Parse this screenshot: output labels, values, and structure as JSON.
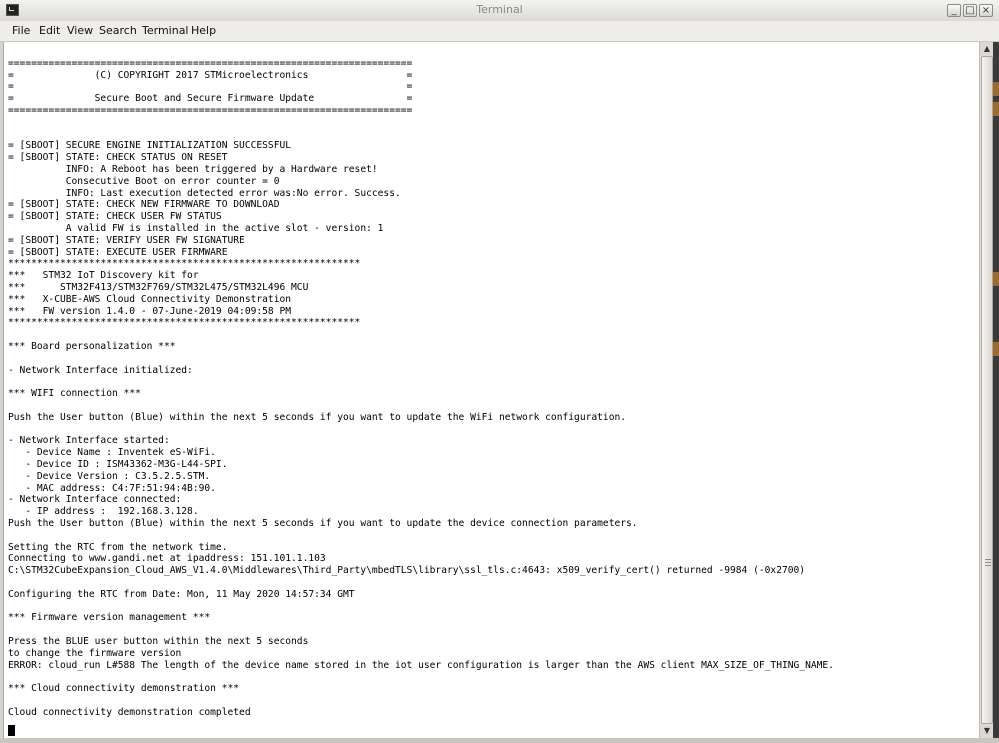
{
  "window": {
    "title": "Terminal"
  },
  "menu": [
    "File",
    "Edit",
    "View",
    "Search",
    "Terminal",
    "Help"
  ],
  "terminal_lines": [
    "",
    "======================================================================",
    "=              (C) COPYRIGHT 2017 STMicroelectronics                 =",
    "=                                                                    =",
    "=              Secure Boot and Secure Firmware Update                =",
    "======================================================================",
    "",
    "",
    "= [SBOOT] SECURE ENGINE INITIALIZATION SUCCESSFUL",
    "= [SBOOT] STATE: CHECK STATUS ON RESET",
    "          INFO: A Reboot has been triggered by a Hardware reset!",
    "          Consecutive Boot on error counter = 0",
    "          INFO: Last execution detected error was:No error. Success.",
    "= [SBOOT] STATE: CHECK NEW FIRMWARE TO DOWNLOAD",
    "= [SBOOT] STATE: CHECK USER FW STATUS",
    "          A valid FW is installed in the active slot - version: 1",
    "= [SBOOT] STATE: VERIFY USER FW SIGNATURE",
    "= [SBOOT] STATE: EXECUTE USER FIRMWARE",
    "*************************************************************",
    "***   STM32 IoT Discovery kit for",
    "***      STM32F413/STM32F769/STM32L475/STM32L496 MCU",
    "***   X-CUBE-AWS Cloud Connectivity Demonstration",
    "***   FW version 1.4.0 - 07-June-2019 04:09:58 PM",
    "*************************************************************",
    "",
    "*** Board personalization ***",
    "",
    "- Network Interface initialized:",
    "",
    "*** WIFI connection ***",
    "",
    "Push the User button (Blue) within the next 5 seconds if you want to update the WiFi network configuration.",
    "",
    "- Network Interface started:",
    "   - Device Name : Inventek eS-WiFi.",
    "   - Device ID : ISM43362-M3G-L44-SPI.",
    "   - Device Version : C3.5.2.5.STM.",
    "   - MAC address: C4:7F:51:94:4B:90.",
    "- Network Interface connected:",
    "   - IP address :  192.168.3.128.",
    "Push the User button (Blue) within the next 5 seconds if you want to update the device connection parameters.",
    "",
    "Setting the RTC from the network time.",
    "Connecting to www.gandi.net at ipaddress: 151.101.1.103",
    "C:\\STM32CubeExpansion_Cloud_AWS_V1.4.0\\Middlewares\\Third_Party\\mbedTLS\\library\\ssl_tls.c:4643: x509_verify_cert() returned -9984 (-0x2700)",
    "",
    "Configuring the RTC from Date: Mon, 11 May 2020 14:57:34 GMT",
    "",
    "*** Firmware version management ***",
    "",
    "Press the BLUE user button within the next 5 seconds",
    "to change the firmware version",
    "ERROR: cloud_run L#588 The length of the device name stored in the iot user configuration is larger than the AWS client MAX_SIZE_OF_THING_NAME.",
    "",
    "*** Cloud connectivity demonstration ***",
    "",
    "Cloud connectivity demonstration completed"
  ]
}
